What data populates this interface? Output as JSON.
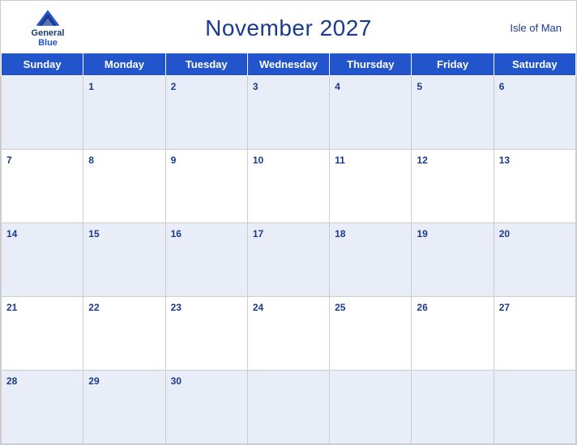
{
  "header": {
    "logo": {
      "line1": "General",
      "line2": "Blue"
    },
    "title": "November 2027",
    "region": "Isle of Man"
  },
  "weekdays": [
    "Sunday",
    "Monday",
    "Tuesday",
    "Wednesday",
    "Thursday",
    "Friday",
    "Saturday"
  ],
  "weeks": [
    [
      {
        "day": "",
        "empty": true
      },
      {
        "day": "1"
      },
      {
        "day": "2"
      },
      {
        "day": "3"
      },
      {
        "day": "4"
      },
      {
        "day": "5"
      },
      {
        "day": "6"
      }
    ],
    [
      {
        "day": "7"
      },
      {
        "day": "8"
      },
      {
        "day": "9"
      },
      {
        "day": "10"
      },
      {
        "day": "11"
      },
      {
        "day": "12"
      },
      {
        "day": "13"
      }
    ],
    [
      {
        "day": "14"
      },
      {
        "day": "15"
      },
      {
        "day": "16"
      },
      {
        "day": "17"
      },
      {
        "day": "18"
      },
      {
        "day": "19"
      },
      {
        "day": "20"
      }
    ],
    [
      {
        "day": "21"
      },
      {
        "day": "22"
      },
      {
        "day": "23"
      },
      {
        "day": "24"
      },
      {
        "day": "25"
      },
      {
        "day": "26"
      },
      {
        "day": "27"
      }
    ],
    [
      {
        "day": "28"
      },
      {
        "day": "29"
      },
      {
        "day": "30"
      },
      {
        "day": "",
        "empty": true
      },
      {
        "day": "",
        "empty": true
      },
      {
        "day": "",
        "empty": true
      },
      {
        "day": "",
        "empty": true
      }
    ]
  ],
  "colors": {
    "header_bg": "#2255cc",
    "shaded_row": "#e8edf8",
    "title_color": "#1a3a8f",
    "day_color": "#1a3a8f"
  }
}
